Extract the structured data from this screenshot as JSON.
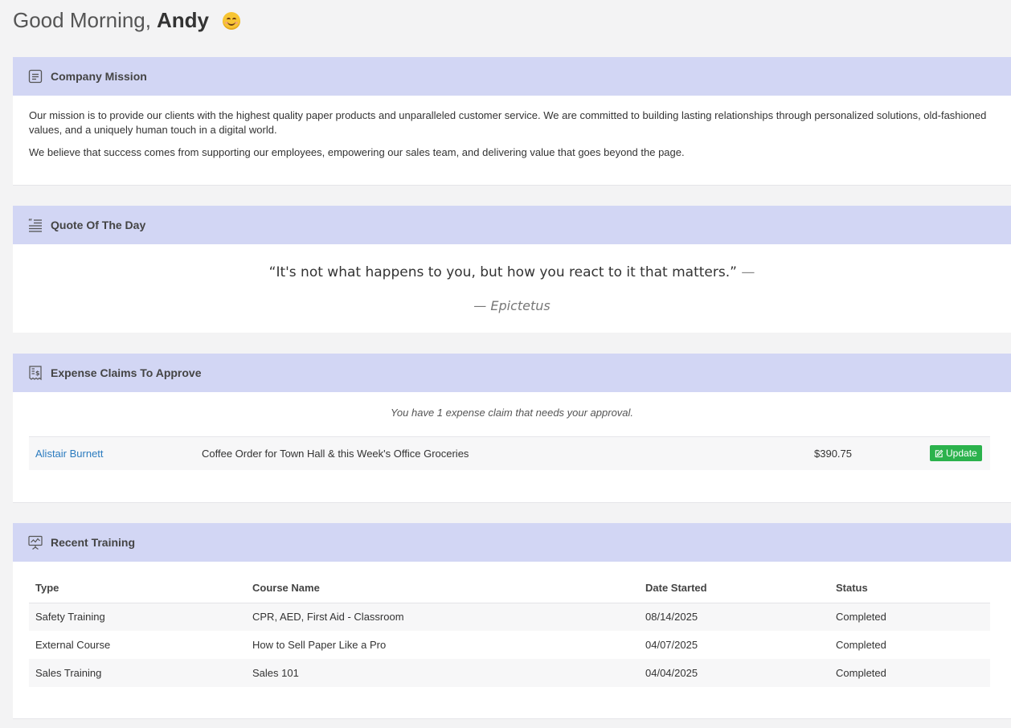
{
  "greeting": {
    "prefix": "Good Morning,",
    "name": "Andy"
  },
  "mission": {
    "title": "Company Mission",
    "paragraphs": [
      "Our mission is to provide our clients with the highest quality paper products and unparalleled customer service. We are committed to building lasting relationships through personalized solutions, old-fashioned values, and a uniquely human touch in a digital world.",
      "We believe that success comes from supporting our employees, empowering our sales team, and delivering value that goes beyond the page."
    ]
  },
  "quote": {
    "title": "Quote Of The Day",
    "text": "“It's not what happens to you, but how you react to it that matters.”",
    "trailing_dash": "—",
    "author": "— Epictetus"
  },
  "expense": {
    "title": "Expense Claims To Approve",
    "note": "You have 1 expense claim that needs your approval.",
    "claims": [
      {
        "name": "Alistair Burnett",
        "description": "Coffee Order for Town Hall & this Week's Office Groceries",
        "amount": "$390.75",
        "action": "Update"
      }
    ]
  },
  "training": {
    "title": "Recent Training",
    "columns": [
      "Type",
      "Course Name",
      "Date Started",
      "Status"
    ],
    "rows": [
      [
        "Safety Training",
        "CPR, AED, First Aid - Classroom",
        "08/14/2025",
        "Completed"
      ],
      [
        "External Course",
        "How to Sell Paper Like a Pro",
        "04/07/2025",
        "Completed"
      ],
      [
        "Sales Training",
        "Sales 101",
        "04/04/2025",
        "Completed"
      ]
    ]
  },
  "colors": {
    "header_band": "#d2d6f4",
    "link": "#2b7bbf",
    "update_button": "#2bb24c"
  },
  "icons": {
    "mission": "document-icon",
    "quote": "quote-list-icon",
    "expense": "receipt-icon",
    "training": "presentation-chart-icon",
    "update": "edit-icon"
  }
}
